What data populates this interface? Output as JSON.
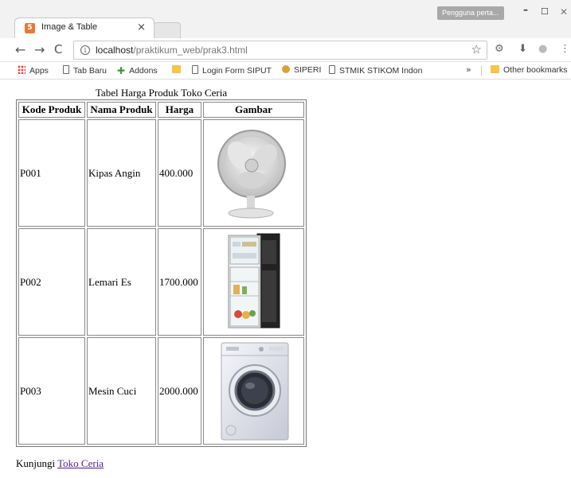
{
  "browser": {
    "tab_title": "Image & Table",
    "tab_close": "×",
    "profile_label": "Pengguna perta...",
    "url_host": "localhost",
    "url_path": "/praktikum_web/prak3.html",
    "bookmarks": [
      {
        "label": "Apps",
        "icon": "apps-grid-icon"
      },
      {
        "label": "Tab Baru",
        "icon": "page-icon"
      },
      {
        "label": "Addons",
        "icon": "puzzle-icon"
      },
      {
        "label": "",
        "icon": "folder-icon"
      },
      {
        "label": "Login Form SIPUT",
        "icon": "page-icon"
      },
      {
        "label": "SIPERI",
        "icon": "site-icon"
      },
      {
        "label": "STMIK STIKOM Indon",
        "icon": "page-icon"
      }
    ],
    "overflow": "»",
    "other_bookmarks": "Other bookmarks"
  },
  "page": {
    "caption": "Tabel Harga Produk Toko Ceria",
    "headers": [
      "Kode Produk",
      "Nama Produk",
      "Harga",
      "Gambar"
    ],
    "rows": [
      {
        "kode": "P001",
        "nama": "Kipas Angin",
        "harga": "400.000",
        "image": "fan-image"
      },
      {
        "kode": "P002",
        "nama": "Lemari Es",
        "harga": "1700.000",
        "image": "refrigerator-image"
      },
      {
        "kode": "P003",
        "nama": "Mesin Cuci",
        "harga": "2000.000",
        "image": "washing-machine-image"
      }
    ],
    "footer_text": "Kunjungi",
    "footer_link": "Toko Ceria"
  },
  "colors": {
    "link_visited": "#551a8b",
    "tab_favicon": "#e8793a"
  }
}
